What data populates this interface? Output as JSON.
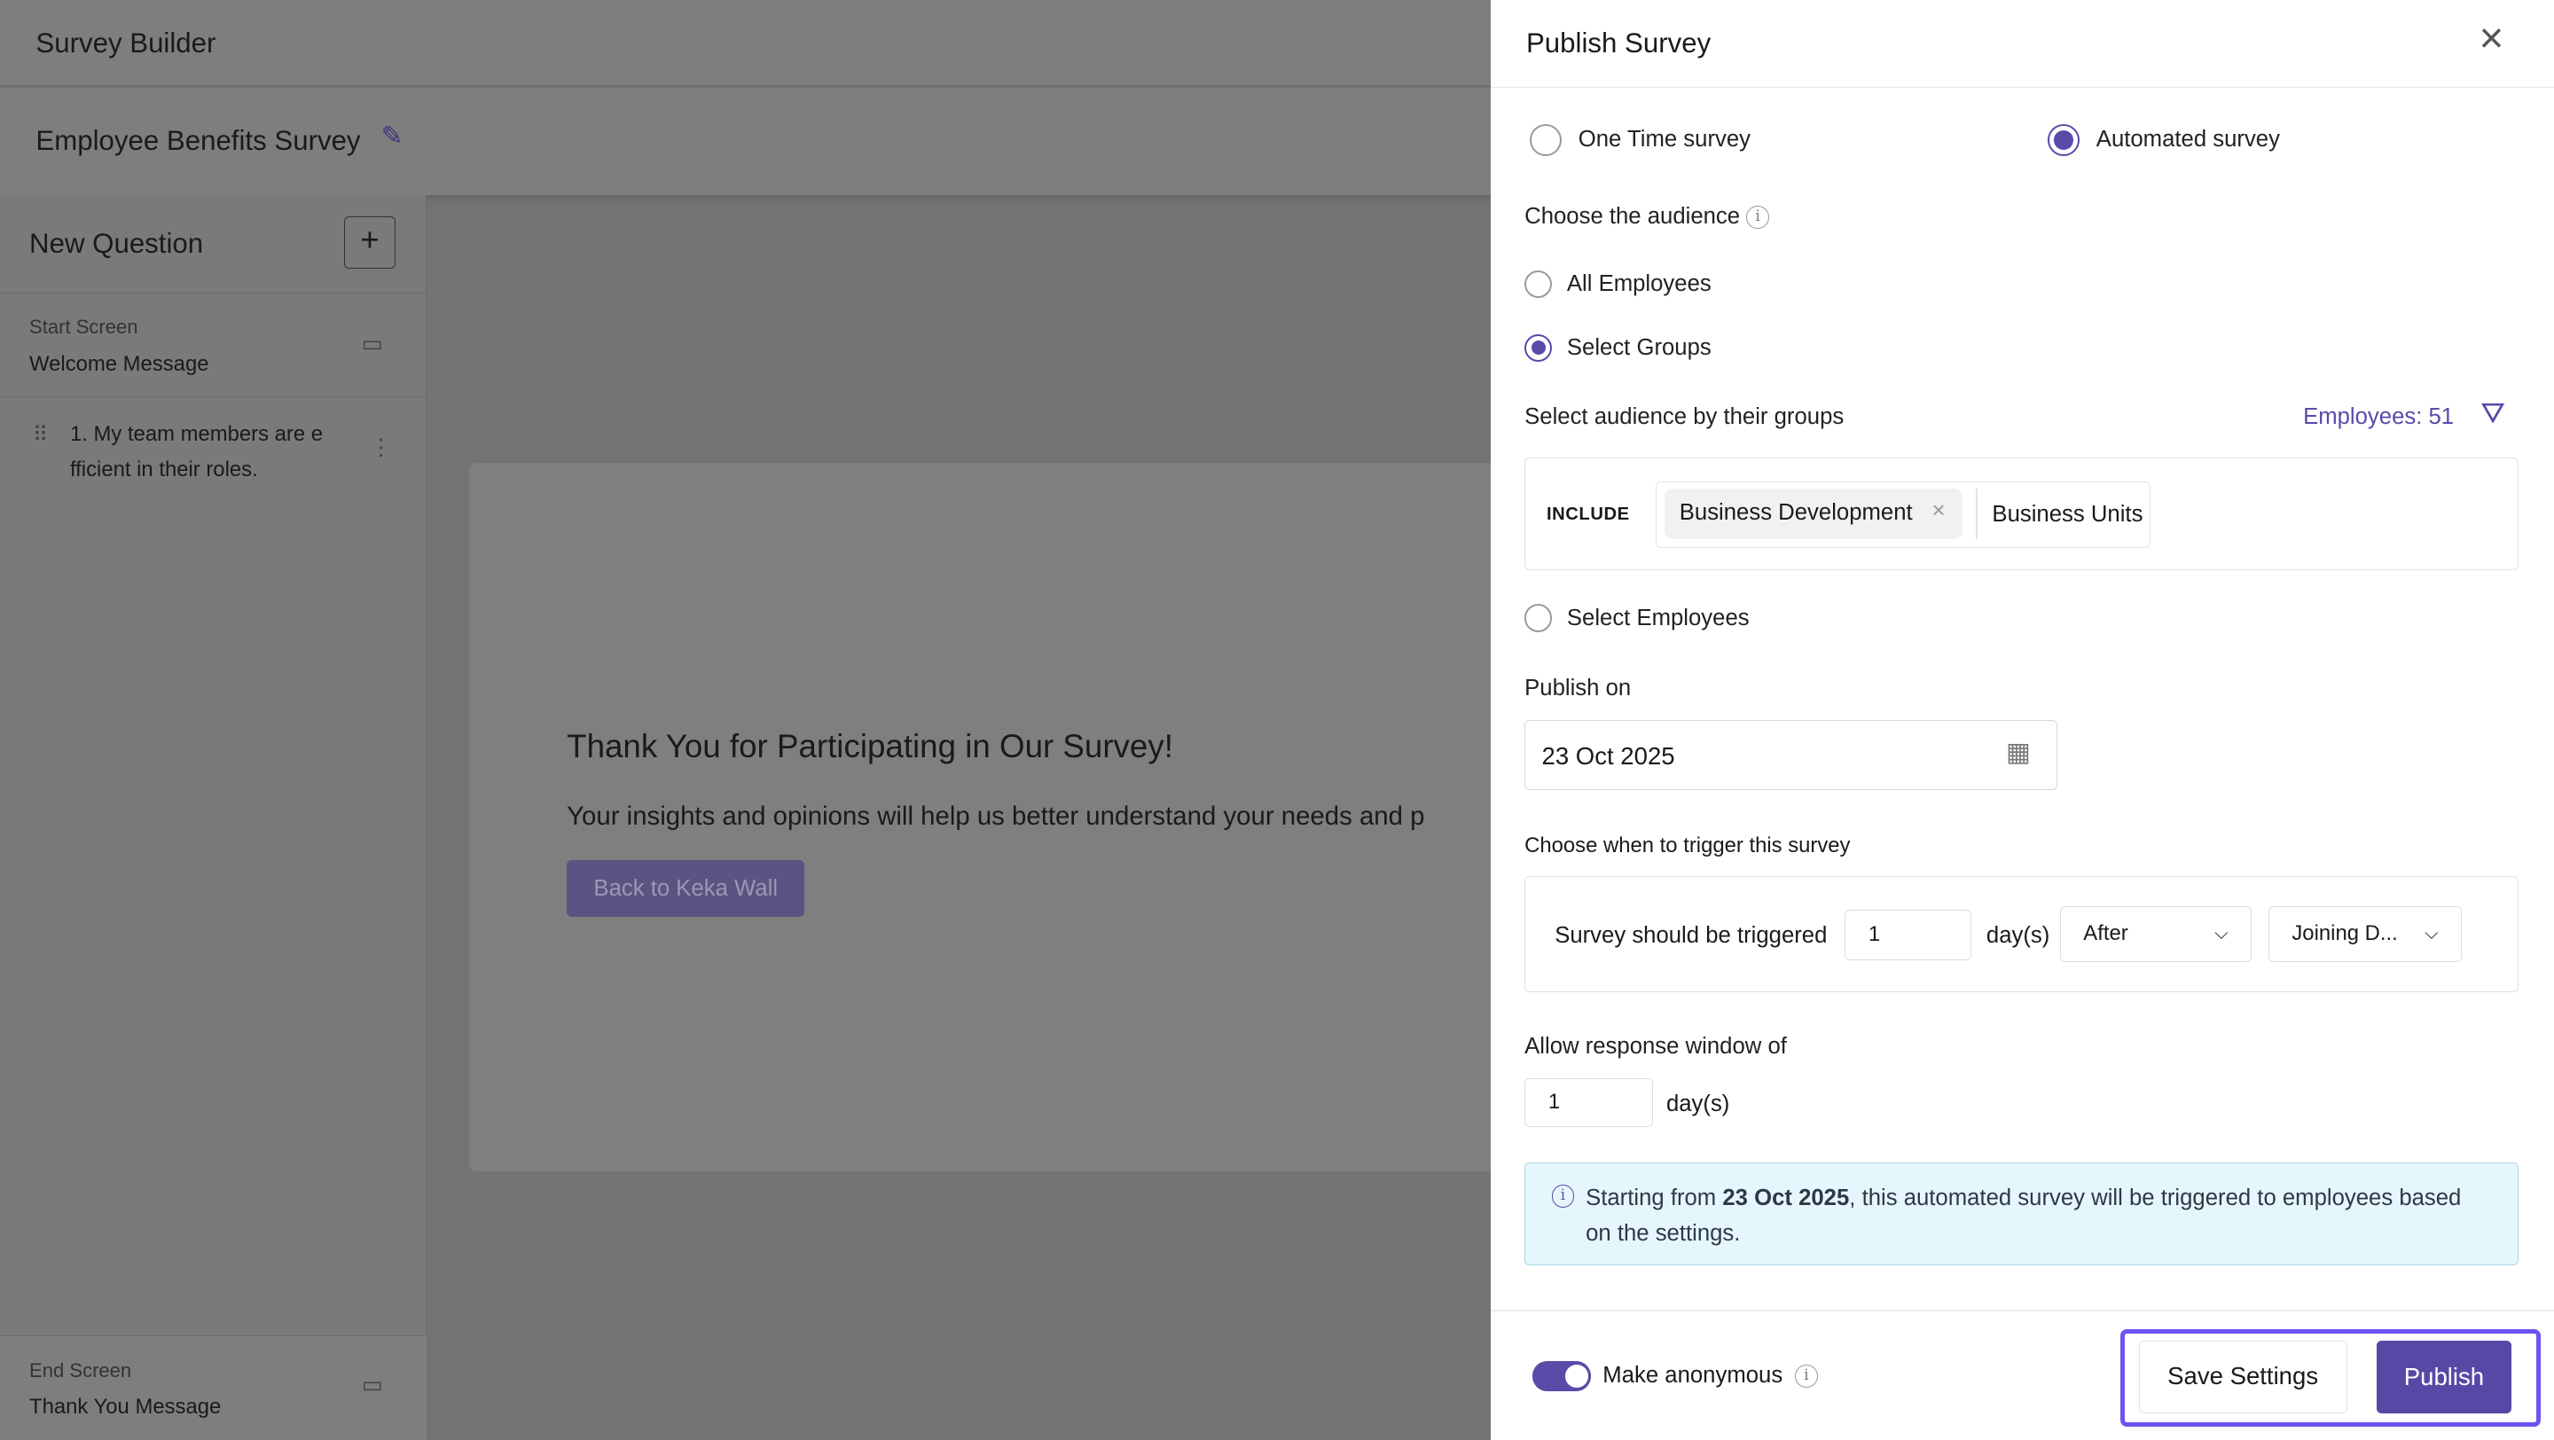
{
  "app": {
    "title": "Survey Builder"
  },
  "survey": {
    "name": "Employee Benefits Survey"
  },
  "sidebar": {
    "new_question": "New Question",
    "start_label": "Start Screen",
    "start_value": "Welcome Message",
    "question_1": "1. My team members are e",
    "question_1b": "fficient in their roles.",
    "end_label": "End Screen",
    "end_value": "Thank You Message"
  },
  "preview": {
    "heading": "Thank You for Participating in Our Survey!",
    "body": "Your insights and opinions will help us better understand your needs and p",
    "button": "Back to Keka Wall"
  },
  "panel": {
    "title": "Publish Survey",
    "type_one_time": "One Time survey",
    "type_automated": "Automated survey",
    "selected_type": "Automated survey",
    "audience_label": "Choose the audience",
    "all_employees": "All Employees",
    "select_groups": "Select Groups",
    "select_employees": "Select Employees",
    "selected_audience": "Select Groups",
    "groups_label": "Select audience by their groups",
    "employee_count": "Employees: 51",
    "include": "INCLUDE",
    "chip": "Business Development",
    "group_type": "Business Units",
    "publish_on_label": "Publish on",
    "publish_date": "23 Oct 2025",
    "trigger_label": "Choose when to trigger this survey",
    "trigger_text": "Survey should be triggered",
    "trigger_days": "1",
    "days_unit": "day(s)",
    "trigger_when": "After",
    "trigger_event": "Joining D...",
    "window_label": "Allow response window of",
    "window_days": "1",
    "info_prefix": "Starting from ",
    "info_date": "23 Oct 2025",
    "info_suffix": ", this automated survey will be triggered to employees based on the settings.",
    "anonymous": "Make anonymous",
    "anonymous_on": true,
    "save": "Save Settings",
    "publish": "Publish"
  },
  "colors": {
    "accent": "#5b4aa8",
    "highlight": "#6a55f0",
    "info_bg": "#e6f6fd"
  }
}
